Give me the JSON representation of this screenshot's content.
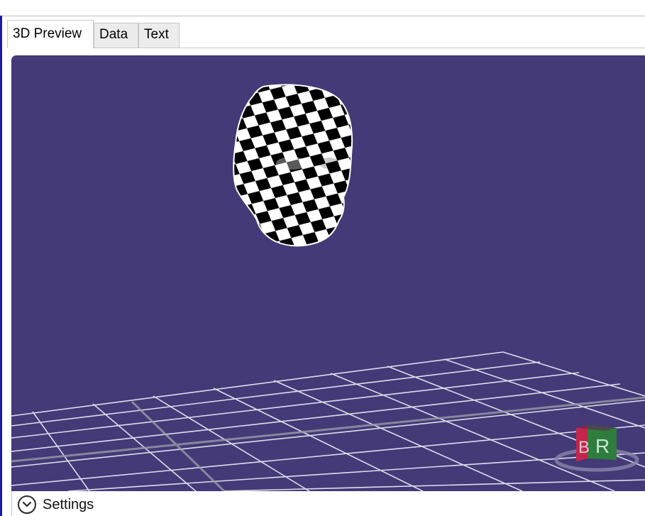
{
  "tabs": [
    {
      "label": "3D Preview",
      "active": true
    },
    {
      "label": "Data",
      "active": false
    },
    {
      "label": "Text",
      "active": false
    }
  ],
  "viewport": {
    "background": "#433a77",
    "grid_color": "#e6e6f2",
    "model": "checkered-head-mesh",
    "gizmo": {
      "left_face_label": "B",
      "right_face_label": "R",
      "left_face_color": "#c4254a",
      "right_face_color": "#2e7d3e"
    }
  },
  "settings": {
    "label": "Settings",
    "icon": "chevron-down-icon"
  }
}
